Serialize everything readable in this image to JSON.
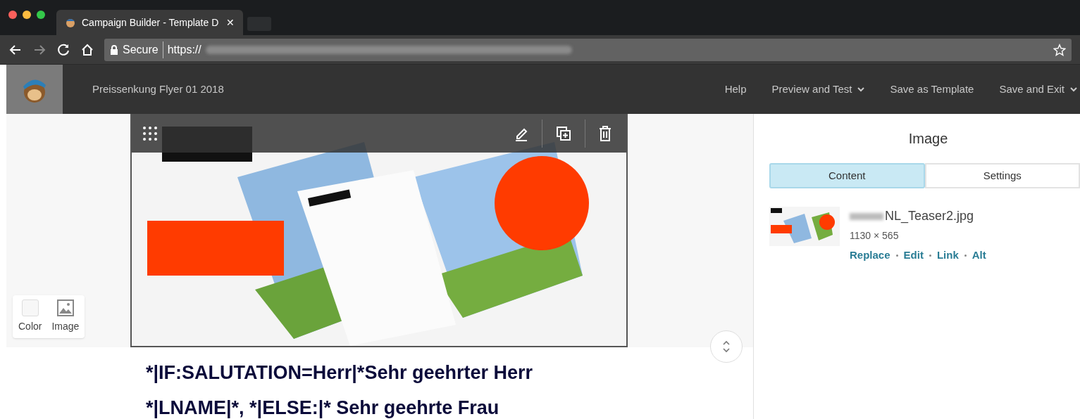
{
  "browser": {
    "tab_title": "Campaign Builder - Template D",
    "tab_close": "✕",
    "secure_label": "Secure",
    "url": "https://"
  },
  "app_header": {
    "campaign_name": "Preissenkung Flyer 01 2018",
    "menu": [
      {
        "label": "Help",
        "dropdown": false
      },
      {
        "label": "Preview and Test",
        "dropdown": true
      },
      {
        "label": "Save as Template",
        "dropdown": false
      },
      {
        "label": "Save and Exit",
        "dropdown": true
      }
    ]
  },
  "canvas": {
    "background_options": [
      "Color",
      "Image"
    ],
    "body_lines": [
      "*|IF:SALUTATION=Herr|*Sehr geehrter Herr",
      "*|LNAME|*, *|ELSE:|* Sehr geehrte Frau"
    ]
  },
  "panel": {
    "title": "Image",
    "tabs": [
      {
        "label": "Content",
        "selected": true
      },
      {
        "label": "Settings",
        "selected": false
      }
    ],
    "file": {
      "name": "NL_Teaser2.jpg",
      "dimensions": "1130 × 565",
      "actions": [
        "Replace",
        "Edit",
        "Link",
        "Alt"
      ]
    }
  }
}
